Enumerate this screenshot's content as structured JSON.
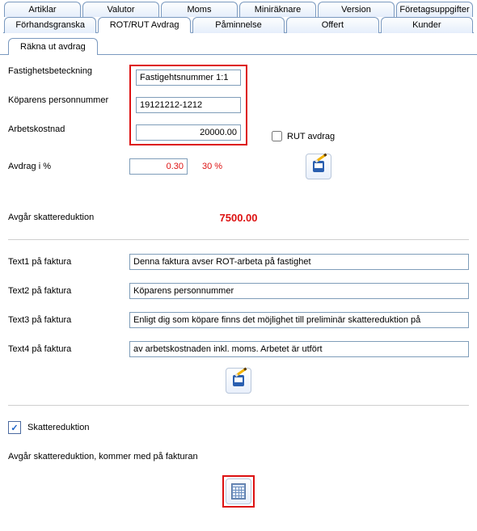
{
  "tabs": {
    "row1": [
      "Artiklar",
      "Valutor",
      "Moms",
      "Miniräknare",
      "Version",
      "Företagsuppgifter"
    ],
    "row2": [
      "Förhandsgranska",
      "ROT/RUT Avdrag",
      "Påminnelse",
      "Offert",
      "Kunder"
    ],
    "active_row2_index": 1
  },
  "subtab": "Räkna ut avdrag",
  "labels": {
    "fastighet": "Fastighetsbeteckning",
    "personnr": "Köparens personnummer",
    "arbkost": "Arbetskostnad",
    "rut": "RUT avdrag",
    "avdragpct": "Avdrag i %",
    "skattered": "Avgår skattereduktion",
    "text1": "Text1 på faktura",
    "text2": "Text2 på faktura",
    "text3": "Text3 på faktura",
    "text4": "Text4 på faktura",
    "skatteredchk": "Skattereduktion",
    "bottom": "Avgår skattereduktion, kommer med på fakturan"
  },
  "values": {
    "fastighet": "Fastigehtsnummer 1:1",
    "personnr": "19121212-1212",
    "arbkost": "20000.00",
    "rut_checked": false,
    "avdragpct": "0.30",
    "avdragpct_display": "30 %",
    "skattered": "7500.00",
    "text1": "Denna faktura avser ROT-arbeta på fastighet",
    "text2": "Köparens personnummer",
    "text3": "Enligt dig som köpare finns det möjlighet till preliminär skattereduktion på",
    "text4": "av arbetskostnaden inkl. moms. Arbetet är utfört",
    "skatteredchk_checked": true
  }
}
